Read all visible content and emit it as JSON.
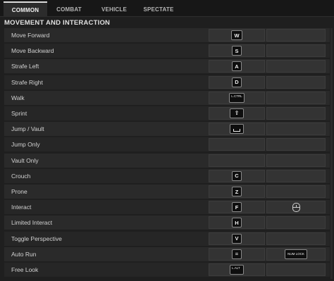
{
  "tabs": [
    {
      "label": "COMMON",
      "active": true
    },
    {
      "label": "COMBAT",
      "active": false
    },
    {
      "label": "VEHICLE",
      "active": false
    },
    {
      "label": "SPECTATE",
      "active": false
    }
  ],
  "section_title": "MOVEMENT AND INTERACTION",
  "rows": [
    {
      "label": "Move Forward",
      "primary": "W",
      "secondary": ""
    },
    {
      "label": "Move Backward",
      "primary": "S",
      "secondary": ""
    },
    {
      "label": "Strafe Left",
      "primary": "A",
      "secondary": ""
    },
    {
      "label": "Strafe Right",
      "primary": "D",
      "secondary": ""
    },
    {
      "label": "Walk",
      "primary": "L.CTRL",
      "secondary": ""
    },
    {
      "label": "Sprint",
      "primary": "shift-icon",
      "secondary": ""
    },
    {
      "label": "Jump / Vault",
      "primary": "space-icon",
      "secondary": ""
    },
    {
      "label": "Jump Only",
      "primary": "",
      "secondary": ""
    },
    {
      "label": "Vault Only",
      "primary": "",
      "secondary": ""
    },
    {
      "label": "Crouch",
      "primary": "C",
      "secondary": ""
    },
    {
      "label": "Prone",
      "primary": "Z",
      "secondary": ""
    },
    {
      "label": "Interact",
      "primary": "F",
      "secondary": "mouse-scroll-icon"
    },
    {
      "label": "Limited Interact",
      "primary": "H",
      "secondary": ""
    },
    {
      "label": "Toggle Perspective",
      "primary": "V",
      "secondary": ""
    },
    {
      "label": "Auto Run",
      "primary": "=",
      "secondary": "NUM LOCK"
    },
    {
      "label": "Free Look",
      "primary": "L.ALT",
      "secondary": ""
    }
  ]
}
